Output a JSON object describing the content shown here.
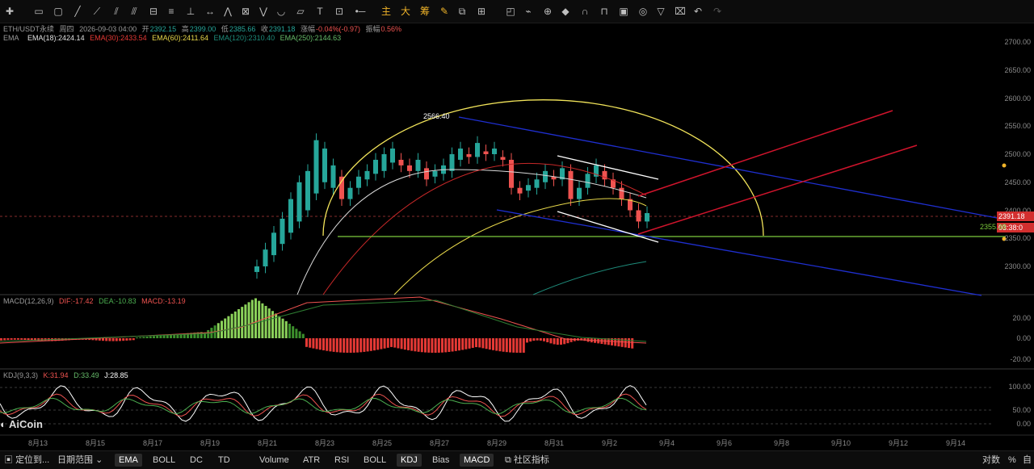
{
  "toolbar": {
    "icons": [
      "line-tool-icon",
      "rect-tool-icon",
      "ray-tool-icon",
      "channel-tool-icon",
      "fib-tool-icon",
      "measure-tool-icon",
      "text-tool-icon",
      "arrow-tool-icon"
    ],
    "label_main": "主",
    "label_big": "大",
    "label_chip": "筹"
  },
  "legend": {
    "symbol": "ETH/USDT永续",
    "period": "周四",
    "datetime": "2026-09-03 04:00",
    "open_label": "开",
    "open": "2392.15",
    "high_label": "高",
    "high": "2399.00",
    "low_label": "低",
    "low": "2385.66",
    "close_label": "收",
    "close": "2391.18",
    "change_label": "涨幅",
    "change": "-0.04%(-0.97)",
    "amp_label": "振幅",
    "amp": "0.56%",
    "ema_title": "EMA",
    "ema18": "EMA(18):2424.14",
    "ema30": "EMA(30):2433.54",
    "ema60": "EMA(60):2411.64",
    "ema120": "EMA(120):2310.40",
    "ema250": "EMA(250):2144.63",
    "macd_title": "MACD(12,26,9)",
    "dif": "DIF:-17.42",
    "dea": "DEA:-10.83",
    "macd": "MACD:-13.19",
    "kdj_title": "KDJ(9,3,3)",
    "k": "K:31.94",
    "d": "D:33.49",
    "j": "J:28.85"
  },
  "price_axis": [
    "2700.00",
    "2650.00",
    "2600.00",
    "2550.00",
    "2500.00",
    "2450.00",
    "2400.00",
    "2350.00",
    "2300.00"
  ],
  "macd_axis": [
    "20.00",
    "0.00",
    "-20.00"
  ],
  "kdj_axis": [
    "100.00",
    "50.00",
    "0.00"
  ],
  "price_tags": {
    "last": "2391.18",
    "countdown": "03:38:0",
    "support": "2355.38",
    "peak": "2566.40"
  },
  "date_axis": [
    "8月13",
    "8月15",
    "8月17",
    "8月19",
    "8月21",
    "8月23",
    "8月25",
    "8月27",
    "8月29",
    "8月31",
    "9月2",
    "9月4",
    "9月6",
    "9月8",
    "9月10",
    "9月12",
    "9月14"
  ],
  "watermark": "AiCoin",
  "bottom": {
    "items": [
      "定位到...",
      "日期范围",
      "EMA",
      "BOLL",
      "DC",
      "TD",
      "Volume",
      "ATR",
      "RSI",
      "BOLL",
      "KDJ",
      "Bias",
      "MACD",
      "社区指标",
      "对数",
      "%",
      "自"
    ],
    "active": [
      "EMA",
      "KDJ",
      "MACD"
    ]
  },
  "colors": {
    "up": "#26a69a",
    "down": "#ef5350",
    "ema18": "#d9d9d9",
    "ema30": "#c62828",
    "ema60": "#e8d84a",
    "ema120": "#1e8b7a",
    "ema250": "#2e7d32",
    "channel": "#1f2fd0",
    "arc": "#f2e45a",
    "support": "#7ccb3c",
    "red_lines": "#d0142c",
    "white_lines": "#ffffff"
  }
}
